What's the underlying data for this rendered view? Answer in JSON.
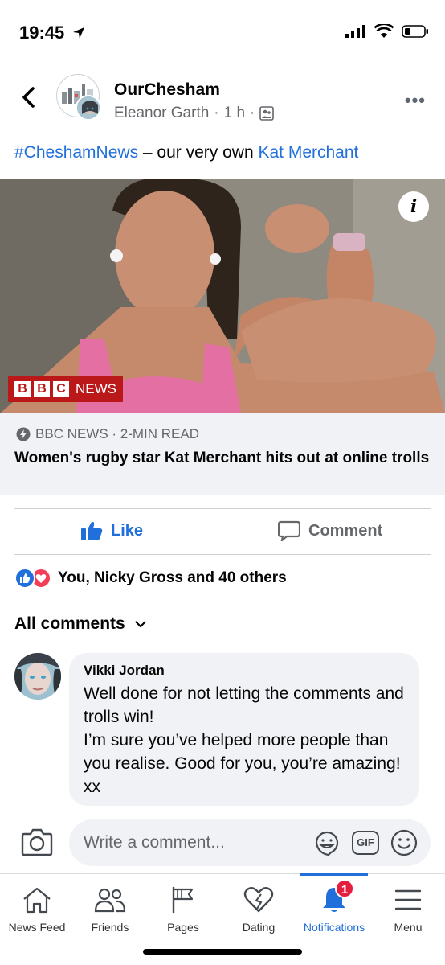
{
  "status_bar": {
    "time": "19:45"
  },
  "post": {
    "page_name": "OurChesham",
    "author": "Eleanor Garth",
    "time_ago": "1 h",
    "hashtag": "#CheshamNews",
    "text_middle": " – our very own ",
    "mention": "Kat Merchant"
  },
  "link_card": {
    "bbc_letters": [
      "B",
      "B",
      "C"
    ],
    "bbc_word": "NEWS",
    "source": "BBC NEWS · 2-MIN READ",
    "title": "Women's rugby star Kat Merchant hits out at online trolls"
  },
  "actions": {
    "like_label": "Like",
    "comment_label": "Comment"
  },
  "reactions": {
    "summary": "You, Nicky Gross and 40 others"
  },
  "comments": {
    "header": "All comments",
    "items": [
      {
        "author": "Vikki Jordan",
        "text": "Well done for not letting the comments and trolls win!\nI’m sure you’ve helped more people than you realise. Good for you, you’re amazing! xx"
      }
    ]
  },
  "composer": {
    "placeholder": "Write a comment...",
    "gif_label": "GIF"
  },
  "tabs": [
    {
      "label": "News Feed",
      "icon": "home-icon"
    },
    {
      "label": "Friends",
      "icon": "friends-icon"
    },
    {
      "label": "Pages",
      "icon": "flag-icon"
    },
    {
      "label": "Dating",
      "icon": "heart-icon"
    },
    {
      "label": "Notifications",
      "icon": "bell-icon",
      "badge": "1",
      "active": true
    },
    {
      "label": "Menu",
      "icon": "menu-icon"
    }
  ],
  "colors": {
    "accent": "#216fdb",
    "bbc_red": "#bb1919",
    "badge_red": "#e41e3f",
    "love_red": "#f33e58"
  }
}
